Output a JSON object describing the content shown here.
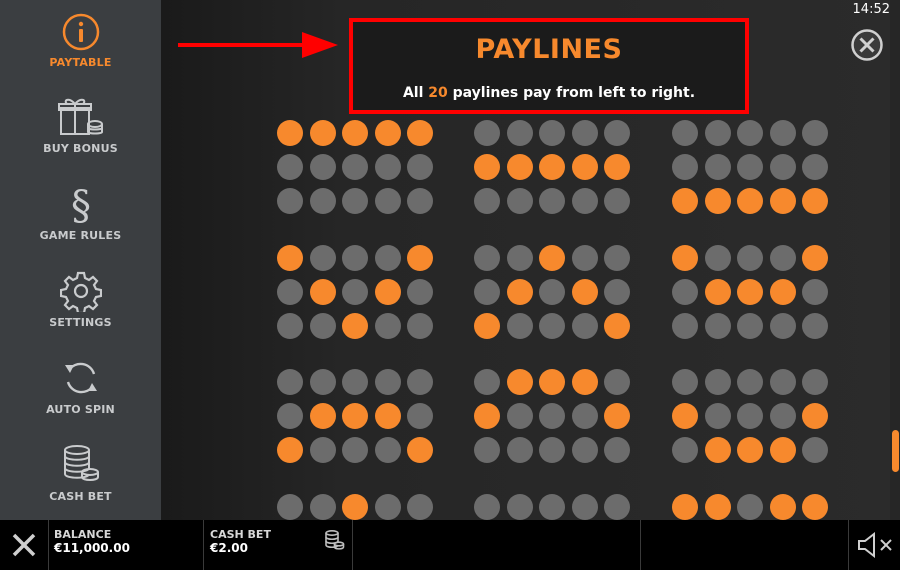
{
  "sidebar": {
    "items": [
      {
        "label": "PAYTABLE",
        "icon": "info-icon",
        "active": true
      },
      {
        "label": "BUY BONUS",
        "icon": "gift-coins-icon",
        "active": false
      },
      {
        "label": "GAME RULES",
        "icon": "section-sign-icon",
        "active": false
      },
      {
        "label": "SETTINGS",
        "icon": "gear-icon",
        "active": false
      },
      {
        "label": "AUTO SPIN",
        "icon": "refresh-icon",
        "active": false
      },
      {
        "label": "CASH BET",
        "icon": "coin-stack-icon",
        "active": false
      }
    ]
  },
  "header": {
    "clock": "14:52",
    "title": "PAYLINES",
    "subtitle_pre": "All",
    "subtitle_num": "20",
    "subtitle_post": "paylines pay from left to right."
  },
  "paylines": [
    [
      [
        1,
        1,
        1,
        1,
        1
      ],
      [
        0,
        0,
        0,
        0,
        0
      ],
      [
        0,
        0,
        0,
        0,
        0
      ]
    ],
    [
      [
        0,
        0,
        0,
        0,
        0
      ],
      [
        1,
        1,
        1,
        1,
        1
      ],
      [
        0,
        0,
        0,
        0,
        0
      ]
    ],
    [
      [
        0,
        0,
        0,
        0,
        0
      ],
      [
        0,
        0,
        0,
        0,
        0
      ],
      [
        1,
        1,
        1,
        1,
        1
      ]
    ],
    [
      [
        1,
        0,
        0,
        0,
        1
      ],
      [
        0,
        1,
        0,
        1,
        0
      ],
      [
        0,
        0,
        1,
        0,
        0
      ]
    ],
    [
      [
        0,
        0,
        1,
        0,
        0
      ],
      [
        0,
        1,
        0,
        1,
        0
      ],
      [
        1,
        0,
        0,
        0,
        1
      ]
    ],
    [
      [
        1,
        0,
        0,
        0,
        1
      ],
      [
        0,
        1,
        1,
        1,
        0
      ],
      [
        0,
        0,
        0,
        0,
        0
      ]
    ],
    [
      [
        0,
        0,
        0,
        0,
        0
      ],
      [
        0,
        1,
        1,
        1,
        0
      ],
      [
        1,
        0,
        0,
        0,
        1
      ]
    ],
    [
      [
        0,
        1,
        1,
        1,
        0
      ],
      [
        1,
        0,
        0,
        0,
        1
      ],
      [
        0,
        0,
        0,
        0,
        0
      ]
    ],
    [
      [
        0,
        0,
        0,
        0,
        0
      ],
      [
        1,
        0,
        0,
        0,
        1
      ],
      [
        0,
        1,
        1,
        1,
        0
      ]
    ],
    [
      [
        0,
        0,
        1,
        0,
        0
      ]
    ],
    [
      [
        0,
        0,
        0,
        0,
        0
      ]
    ],
    [
      [
        1,
        1,
        0,
        1,
        1
      ]
    ]
  ],
  "bottombar": {
    "balance_label": "BALANCE",
    "balance_value": "€11,000.00",
    "cashbet_label": "CASH BET",
    "cashbet_value": "€2.00"
  },
  "colors": {
    "accent": "#f7892d",
    "dot_off": "#6c6c6c",
    "annotation": "#ff0000",
    "sidebar_bg": "#3b3e41"
  }
}
